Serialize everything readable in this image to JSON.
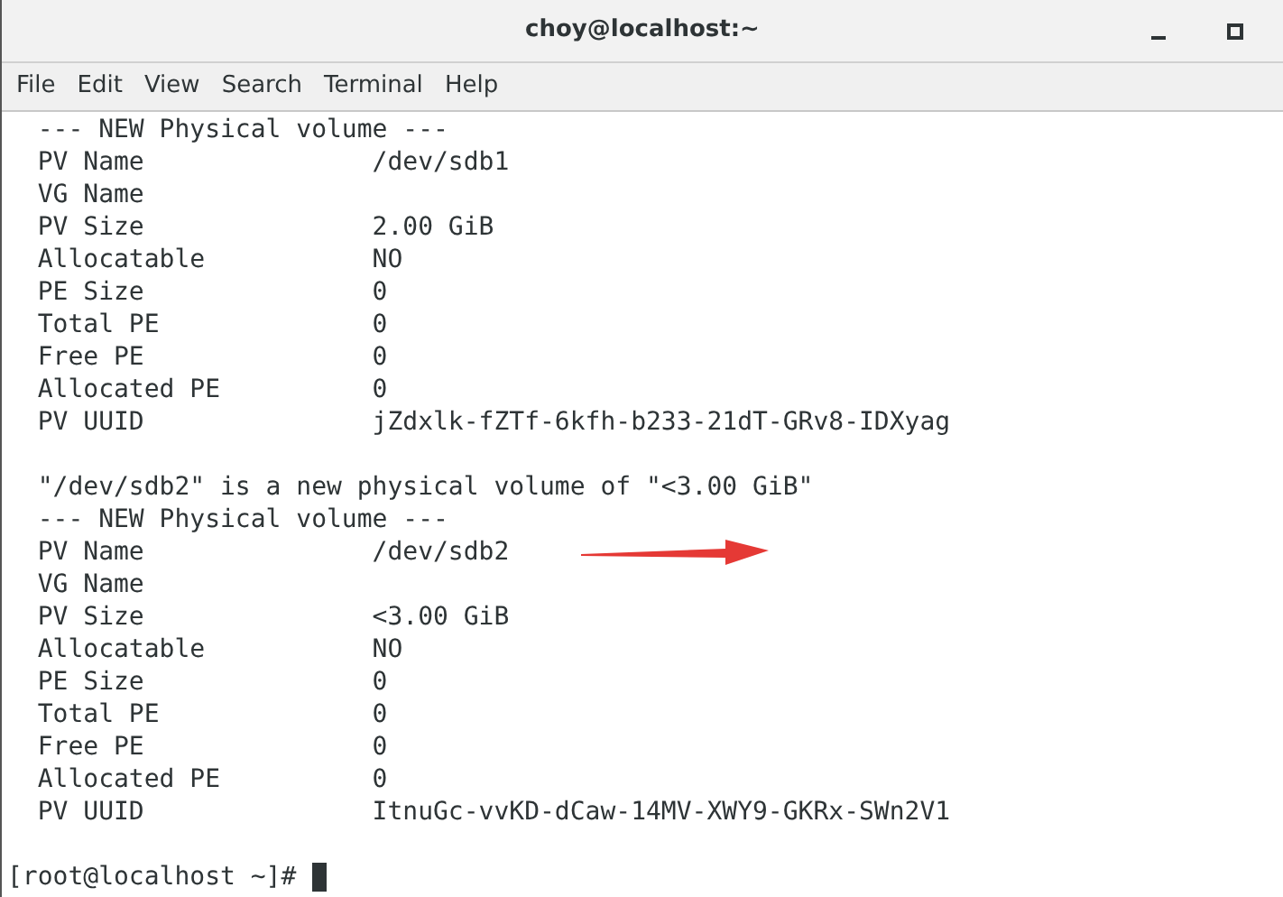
{
  "window": {
    "title": "choy@localhost:~"
  },
  "menu": [
    "File",
    "Edit",
    "View",
    "Search",
    "Terminal",
    "Help"
  ],
  "terminal": {
    "lines": [
      {
        "kind": "text",
        "text": "  --- NEW Physical volume ---"
      },
      {
        "kind": "text",
        "text": "  PV Name               /dev/sdb1"
      },
      {
        "kind": "text",
        "text": "  VG Name"
      },
      {
        "kind": "text",
        "text": "  PV Size               2.00 GiB"
      },
      {
        "kind": "text",
        "text": "  Allocatable           NO"
      },
      {
        "kind": "text",
        "text": "  PE Size               0"
      },
      {
        "kind": "text",
        "text": "  Total PE              0"
      },
      {
        "kind": "text",
        "text": "  Free PE               0"
      },
      {
        "kind": "text",
        "text": "  Allocated PE          0"
      },
      {
        "kind": "text",
        "text": "  PV UUID               jZdxlk-fZTf-6kfh-b233-21dT-GRv8-IDXyag"
      },
      {
        "kind": "blank"
      },
      {
        "kind": "text",
        "text": "  \"/dev/sdb2\" is a new physical volume of \"<3.00 GiB\""
      },
      {
        "kind": "text",
        "text": "  --- NEW Physical volume ---"
      },
      {
        "kind": "text",
        "text": "  PV Name               /dev/sdb2",
        "arrow": true
      },
      {
        "kind": "text",
        "text": "  VG Name"
      },
      {
        "kind": "text",
        "text": "  PV Size               <3.00 GiB"
      },
      {
        "kind": "text",
        "text": "  Allocatable           NO"
      },
      {
        "kind": "text",
        "text": "  PE Size               0"
      },
      {
        "kind": "text",
        "text": "  Total PE              0"
      },
      {
        "kind": "text",
        "text": "  Free PE               0"
      },
      {
        "kind": "text",
        "text": "  Allocated PE          0"
      },
      {
        "kind": "text",
        "text": "  PV UUID               ItnuGc-vvKD-dCaw-14MV-XWY9-GKRx-SWn2V1"
      },
      {
        "kind": "blank"
      },
      {
        "kind": "prompt",
        "text": "[root@localhost ~]# "
      }
    ]
  }
}
